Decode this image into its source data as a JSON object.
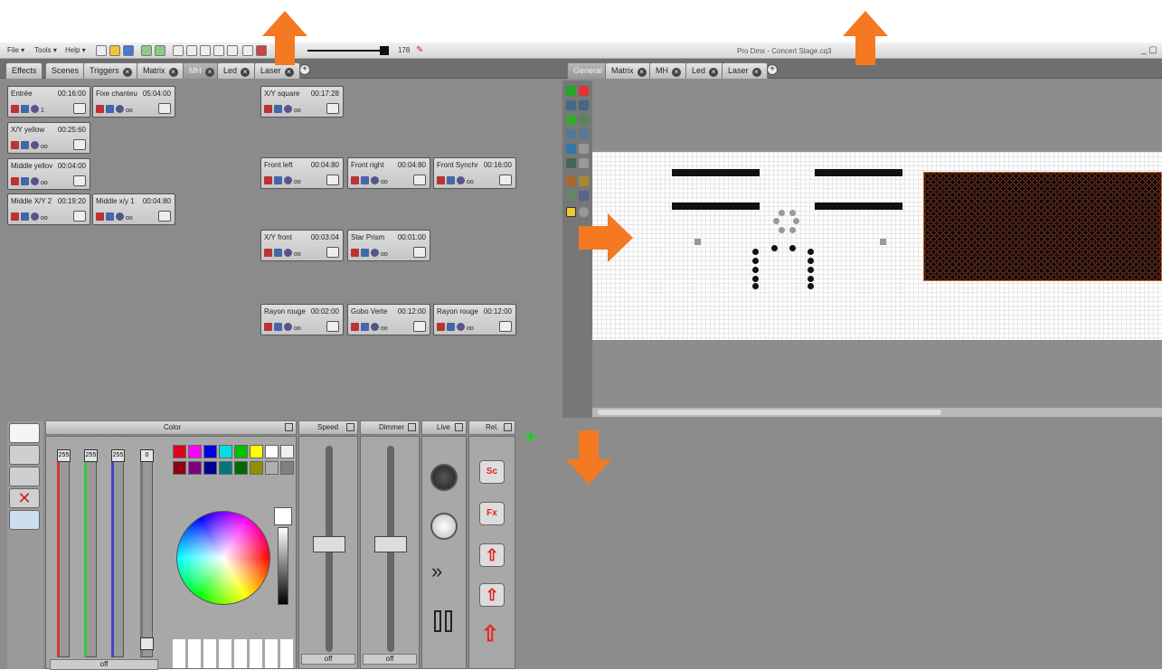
{
  "menubar": {
    "file": "File ▾",
    "tools": "Tools ▾",
    "help": "Help ▾",
    "zoom_value": "178",
    "title": "Pro Dmx - Concert Stage.cq3"
  },
  "left_tabs": [
    {
      "label": "Effects",
      "close": false
    },
    {
      "label": "Scenes",
      "close": false
    },
    {
      "label": "Triggers",
      "close": true
    },
    {
      "label": "Matrix",
      "close": true
    },
    {
      "label": "MH",
      "close": true,
      "active": true
    },
    {
      "label": "Led",
      "close": true
    },
    {
      "label": "Laser",
      "close": true
    }
  ],
  "right_tabs": [
    {
      "label": "General",
      "close": false,
      "active": true
    },
    {
      "label": "Matrix",
      "close": true
    },
    {
      "label": "MH",
      "close": true
    },
    {
      "label": "Led",
      "close": true
    },
    {
      "label": "Laser",
      "close": true
    }
  ],
  "cards": [
    {
      "name": "Entrée",
      "time": "00:16:00",
      "extra": "1"
    },
    {
      "name": "Fixe chanteu",
      "time": "05:04:00",
      "extra": "oo"
    },
    {
      "name": "X/Y yellow",
      "time": "00:25:60",
      "extra": "oo"
    },
    {
      "name": "Middle yellov",
      "time": "00:04:00",
      "extra": "oo"
    },
    {
      "name": "Middle X/Y 2",
      "time": "00:19:20",
      "extra": "oo"
    },
    {
      "name": "Middle x/y 1",
      "time": "00:04:80",
      "extra": "oo"
    },
    {
      "name": "X/Y square",
      "time": "00:17:28",
      "extra": "oo"
    },
    {
      "name": "Front left",
      "time": "00:04:80",
      "extra": "oo"
    },
    {
      "name": "Front right",
      "time": "00:04:80",
      "extra": "oo"
    },
    {
      "name": "Front Synchr",
      "time": "00:16:00",
      "extra": "oo"
    },
    {
      "name": "X/Y front",
      "time": "00:03:04",
      "extra": "oo"
    },
    {
      "name": "Star Prism",
      "time": "00:01:00",
      "extra": "oo"
    },
    {
      "name": "Rayon rouge",
      "time": "00:02:00",
      "extra": "oo"
    },
    {
      "name": "Gobo Verte",
      "time": "00:12:00",
      "extra": "oo"
    },
    {
      "name": "Rayon rouge",
      "time": "00:12:00",
      "extra": "oo"
    }
  ],
  "bottom": {
    "color_header": "Color",
    "speed_header": "Speed",
    "dimmer_header": "Dimmer",
    "live_header": "Live",
    "rel_header": "Rel.",
    "red_value": "255",
    "green_value": "255",
    "blue_value": "255",
    "white_value": "0",
    "color_off": "off",
    "speed_off": "off",
    "dimmer_off": "off",
    "swatches_top": [
      "#e0001b",
      "#ff00ff",
      "#0000e0",
      "#00e0e0",
      "#00c000",
      "#ffff00",
      "#ffffff",
      "#f0f0f0"
    ],
    "swatches_bottom": [
      "#900010",
      "#800080",
      "#000090",
      "#007878",
      "#006a00",
      "#909000",
      "#b0b0b0",
      "#808080"
    ],
    "rel_labels": [
      "Sc",
      "Fx",
      "",
      "",
      ""
    ]
  }
}
